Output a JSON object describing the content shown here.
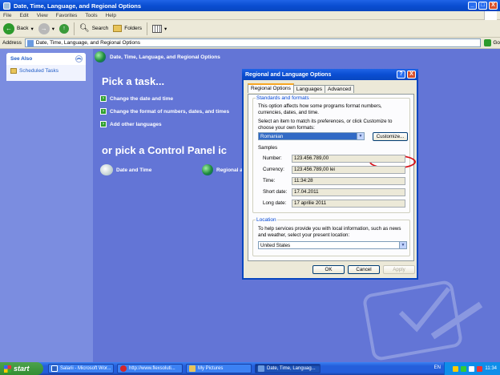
{
  "window": {
    "title": "Date, Time, Language, and Regional Options",
    "buttons": {
      "minimize": "_",
      "maximize": "□",
      "close": "X"
    }
  },
  "menu": [
    "File",
    "Edit",
    "View",
    "Favorites",
    "Tools",
    "Help"
  ],
  "toolbar": {
    "back": "Back",
    "search": "Search",
    "folders": "Folders"
  },
  "address": {
    "label": "Address",
    "value": "Date, Time, Language, and Regional Options",
    "go": "Go"
  },
  "sidebar": {
    "heading": "See Also",
    "items": [
      {
        "label": "Scheduled Tasks"
      }
    ]
  },
  "main": {
    "header": "Date, Time, Language, and Regional Options",
    "pick_task": "Pick a task...",
    "tasks": [
      {
        "label": "Change the date and time"
      },
      {
        "label": "Change the format of numbers, dates, and times"
      },
      {
        "label": "Add other languages"
      }
    ],
    "or_pick": "or pick a Control Panel ic",
    "icons": [
      {
        "label": "Date and Time"
      },
      {
        "label": "Regional a"
      }
    ]
  },
  "dialog": {
    "title": "Regional and Language Options",
    "tabs": [
      "Regional Options",
      "Languages",
      "Advanced"
    ],
    "active_tab": "Regional Options",
    "standards": {
      "legend": "Standards and formats",
      "desc": "This option affects how some programs format numbers, currencies, dates, and time.",
      "select_hint": "Select an item to match its preferences, or click Customize to choose your own formats:",
      "selected_locale": "Romanian",
      "customize": "Customize...",
      "samples_label": "Samples",
      "samples": [
        {
          "label": "Number:",
          "value": "123.456.789,00"
        },
        {
          "label": "Currency:",
          "value": "123.456.789,00 lei"
        },
        {
          "label": "Time:",
          "value": "11:34:28"
        },
        {
          "label": "Short date:",
          "value": "17.04.2011"
        },
        {
          "label": "Long date:",
          "value": "17 aprilie 2011"
        }
      ]
    },
    "location": {
      "legend": "Location",
      "desc": "To help services provide you with local information, such as news and weather, select your present location:",
      "selected": "United States"
    },
    "buttons": {
      "ok": "OK",
      "cancel": "Cancel",
      "apply": "Apply"
    }
  },
  "taskbar": {
    "start": "start",
    "tasks": [
      {
        "label": "Salarii - Microsoft Wor..."
      },
      {
        "label": "http://www.flexsoluti..."
      },
      {
        "label": "My Pictures"
      },
      {
        "label": "Date, Time, Languag..."
      }
    ],
    "lang": "EN",
    "clock": "11:34"
  },
  "colors": {
    "accent": "#0a4ed2",
    "panel": "#6375d6",
    "highlight": "#d7141a"
  }
}
